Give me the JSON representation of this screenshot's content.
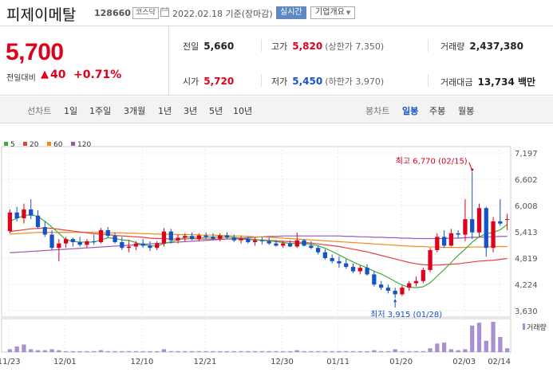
{
  "header": {
    "name": "피제이메탈",
    "code": "128660",
    "market": "코스닥",
    "date": "2022.02.18 기준(장마감)",
    "realtime": "실시간",
    "company_info": "기업개요",
    "dropdown_glyph": "▼"
  },
  "quote": {
    "price": "5,700",
    "change_label": "전일대비",
    "change_arrow": "▲",
    "change_value": "40",
    "change_pct": "+0.71%",
    "prev_label": "전일",
    "prev_value": "5,660",
    "high_label": "고가",
    "high_value": "5,820",
    "high_limit": "(상한가 7,350)",
    "volume_label": "거래량",
    "volume_value": "2,437,380",
    "open_label": "시가",
    "open_value": "5,720",
    "low_label": "저가",
    "low_value": "5,450",
    "low_limit": "(하한가 3,970)",
    "amount_label": "거래대금",
    "amount_value": "13,734 백만"
  },
  "tabs": {
    "line_chart": "선차트",
    "periods": [
      "1일",
      "1주일",
      "3개월",
      "1년",
      "3년",
      "5년",
      "10년"
    ],
    "candle_chart": "봉차트",
    "candle_periods": [
      "일봉",
      "주봉",
      "월봉"
    ],
    "selected_candle": "일봉"
  },
  "colors": {
    "up": "#e0001b",
    "down": "#1553c8",
    "ma5": "#3cae3c",
    "ma20": "#e8403c",
    "ma60": "#f08c1e",
    "ma120": "#9b59b6",
    "volume": "#a98fd0"
  },
  "chart_data": {
    "type": "candlestick",
    "legend": [
      {
        "name": "5",
        "color": "#3cae3c"
      },
      {
        "name": "20",
        "color": "#e8403c"
      },
      {
        "name": "60",
        "color": "#f08c1e"
      },
      {
        "name": "120",
        "color": "#9b59b6"
      }
    ],
    "volume_legend": "거래량",
    "y_ticks": [
      "7,197",
      "6,602",
      "6,008",
      "5,413",
      "4,819",
      "4,224",
      "3,630"
    ],
    "ylim": [
      3630,
      7197
    ],
    "x_ticks": [
      "11/23",
      "12/01",
      "12/10",
      "12/21",
      "12/30",
      "01/11",
      "01/20",
      "02/03",
      "02/14"
    ],
    "annotation_high": "최고 6,770 (02/15)",
    "annotation_low": "최저 3,915 (01/28)",
    "candles": [
      [
        5430,
        5920,
        5380,
        5850
      ],
      [
        5850,
        5980,
        5650,
        5720
      ],
      [
        5720,
        6050,
        5600,
        5920
      ],
      [
        5920,
        6150,
        5700,
        5780
      ],
      [
        5780,
        5900,
        5480,
        5520
      ],
      [
        5520,
        5650,
        5300,
        5350
      ],
      [
        5350,
        5450,
        5000,
        5050
      ],
      [
        5050,
        5250,
        4750,
        5150
      ],
      [
        5150,
        5300,
        5050,
        5250
      ],
      [
        5250,
        5280,
        5080,
        5180
      ],
      [
        5180,
        5300,
        5080,
        5120
      ],
      [
        5120,
        5250,
        5050,
        5200
      ],
      [
        5200,
        5350,
        5120,
        5180
      ],
      [
        5180,
        5500,
        5150,
        5450
      ],
      [
        5450,
        5520,
        5280,
        5320
      ],
      [
        5320,
        5400,
        5150,
        5180
      ],
      [
        5180,
        5300,
        5000,
        5050
      ],
      [
        5050,
        5220,
        4950,
        5080
      ],
      [
        5080,
        5200,
        5000,
        5150
      ],
      [
        5150,
        5250,
        5050,
        5100
      ],
      [
        5100,
        5200,
        4980,
        5050
      ],
      [
        5050,
        5200,
        5000,
        5150
      ],
      [
        5150,
        5500,
        5080,
        5420
      ],
      [
        5420,
        5480,
        5150,
        5220
      ],
      [
        5220,
        5350,
        5150,
        5280
      ],
      [
        5280,
        5380,
        5200,
        5320
      ],
      [
        5320,
        5400,
        5220,
        5250
      ],
      [
        5250,
        5380,
        5200,
        5330
      ],
      [
        5330,
        5400,
        5250,
        5300
      ],
      [
        5300,
        5380,
        5220,
        5260
      ],
      [
        5260,
        5380,
        5200,
        5330
      ],
      [
        5330,
        5400,
        5250,
        5280
      ],
      [
        5280,
        5350,
        5180,
        5220
      ],
      [
        5220,
        5320,
        5150,
        5260
      ],
      [
        5260,
        5300,
        5150,
        5180
      ],
      [
        5180,
        5280,
        5100,
        5220
      ],
      [
        5220,
        5300,
        5130,
        5200
      ],
      [
        5200,
        5280,
        5120,
        5150
      ],
      [
        5150,
        5230,
        5080,
        5100
      ],
      [
        5100,
        5200,
        5050,
        5150
      ],
      [
        5150,
        5220,
        5070,
        5080
      ],
      [
        5080,
        5400,
        5050,
        5220
      ],
      [
        5220,
        5250,
        5080,
        5100
      ],
      [
        5100,
        5200,
        5020,
        5050
      ],
      [
        5050,
        5100,
        4900,
        4950
      ],
      [
        4950,
        5020,
        4780,
        4820
      ],
      [
        4820,
        4900,
        4700,
        4750
      ],
      [
        4750,
        4850,
        4600,
        4700
      ],
      [
        4700,
        4800,
        4580,
        4620
      ],
      [
        4620,
        4700,
        4480,
        4520
      ],
      [
        4520,
        4650,
        4450,
        4600
      ],
      [
        4600,
        4680,
        4420,
        4450
      ],
      [
        4450,
        4520,
        4180,
        4220
      ],
      [
        4220,
        4300,
        4100,
        4150
      ],
      [
        4150,
        4220,
        4020,
        4080
      ],
      [
        4080,
        4150,
        3915,
        4000
      ],
      [
        4000,
        4200,
        3960,
        4150
      ],
      [
        4150,
        4300,
        4080,
        4250
      ],
      [
        4250,
        4400,
        4180,
        4300
      ],
      [
        4300,
        4600,
        4250,
        4550
      ],
      [
        4550,
        5050,
        4500,
        5000
      ],
      [
        5000,
        5380,
        4950,
        5300
      ],
      [
        5300,
        5450,
        5050,
        5100
      ],
      [
        5100,
        5480,
        5080,
        5380
      ],
      [
        5380,
        5450,
        5280,
        5350
      ],
      [
        5350,
        6150,
        5200,
        5700
      ],
      [
        5700,
        6770,
        5250,
        5400
      ],
      [
        5400,
        6050,
        5300,
        5950
      ],
      [
        5950,
        5980,
        4850,
        5050
      ],
      [
        5050,
        5750,
        4950,
        5650
      ],
      [
        5650,
        6150,
        5550,
        5600
      ],
      [
        5700,
        5820,
        5450,
        5700
      ]
    ],
    "ma5": [
      5650,
      5720,
      5780,
      5800,
      5760,
      5650,
      5520,
      5380,
      5230,
      5200,
      5180,
      5180,
      5180,
      5230,
      5280,
      5260,
      5230,
      5220,
      5170,
      5120,
      5100,
      5090,
      5150,
      5190,
      5230,
      5290,
      5300,
      5280,
      5290,
      5300,
      5290,
      5300,
      5290,
      5270,
      5250,
      5240,
      5220,
      5210,
      5190,
      5170,
      5150,
      5150,
      5150,
      5130,
      5100,
      5040,
      4970,
      4890,
      4810,
      4730,
      4660,
      4600,
      4520,
      4460,
      4380,
      4290,
      4210,
      4160,
      4150,
      4170,
      4260,
      4410,
      4560,
      4720,
      4880,
      5020,
      5180,
      5300,
      5370,
      5400,
      5460,
      5580
    ],
    "ma20": [
      5420,
      5440,
      5460,
      5480,
      5490,
      5500,
      5490,
      5470,
      5450,
      5430,
      5410,
      5390,
      5370,
      5360,
      5350,
      5330,
      5320,
      5310,
      5300,
      5290,
      5270,
      5260,
      5260,
      5250,
      5250,
      5250,
      5260,
      5250,
      5250,
      5250,
      5250,
      5250,
      5250,
      5250,
      5240,
      5230,
      5230,
      5220,
      5210,
      5200,
      5190,
      5180,
      5170,
      5160,
      5140,
      5120,
      5100,
      5080,
      5050,
      5020,
      4990,
      4960,
      4920,
      4880,
      4840,
      4800,
      4760,
      4720,
      4690,
      4670,
      4660,
      4660,
      4670,
      4680,
      4690,
      4710,
      4730,
      4750,
      4760,
      4770,
      4790,
      4810
    ],
    "ma60": [
      5360,
      5370,
      5380,
      5390,
      5400,
      5400,
      5400,
      5400,
      5400,
      5400,
      5400,
      5400,
      5400,
      5400,
      5390,
      5390,
      5390,
      5380,
      5380,
      5370,
      5370,
      5360,
      5360,
      5360,
      5350,
      5350,
      5350,
      5340,
      5340,
      5340,
      5330,
      5330,
      5320,
      5320,
      5310,
      5300,
      5300,
      5290,
      5280,
      5270,
      5260,
      5250,
      5240,
      5230,
      5220,
      5210,
      5200,
      5190,
      5180,
      5170,
      5160,
      5150,
      5140,
      5130,
      5120,
      5110,
      5100,
      5090,
      5080,
      5080,
      5070,
      5070,
      5060,
      5060,
      5060,
      5060,
      5070,
      5070,
      5070,
      5080,
      5080,
      5080
    ],
    "ma120": [
      4940,
      4950,
      4960,
      4970,
      4980,
      4990,
      5000,
      5010,
      5020,
      5030,
      5040,
      5050,
      5060,
      5070,
      5080,
      5090,
      5100,
      5110,
      5120,
      5130,
      5140,
      5150,
      5160,
      5170,
      5180,
      5190,
      5200,
      5210,
      5220,
      5230,
      5240,
      5250,
      5260,
      5270,
      5280,
      5290,
      5300,
      5310,
      5310,
      5320,
      5320,
      5320,
      5320,
      5320,
      5320,
      5320,
      5320,
      5320,
      5310,
      5310,
      5300,
      5300,
      5290,
      5290,
      5280,
      5280,
      5270,
      5270,
      5260,
      5260,
      5260,
      5260,
      5260,
      5270,
      5270,
      5280,
      5290,
      5290,
      5300,
      5300,
      5310,
      5310
    ],
    "volume": [
      3,
      6,
      8,
      3,
      2,
      2,
      3,
      2,
      1,
      1,
      1,
      1,
      1,
      2,
      1,
      1,
      1,
      1,
      1,
      1,
      1,
      1,
      3,
      1,
      1,
      1,
      1,
      1,
      1,
      1,
      1,
      1,
      1,
      1,
      1,
      1,
      1,
      1,
      1,
      1,
      1,
      2,
      1,
      1,
      1,
      1,
      1,
      1,
      1,
      1,
      1,
      1,
      2,
      1,
      1,
      3,
      1,
      1,
      1,
      1,
      4,
      9,
      10,
      3,
      2,
      3,
      28,
      31,
      12,
      32,
      16,
      4
    ]
  }
}
